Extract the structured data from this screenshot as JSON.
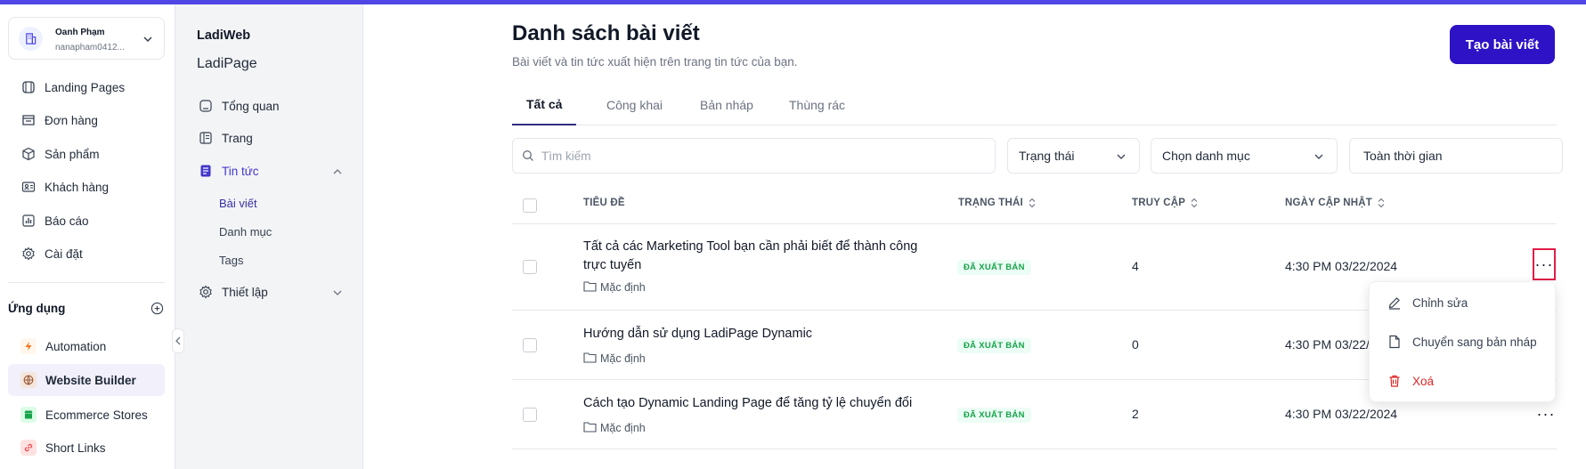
{
  "account": {
    "name": "Oanh Phạm",
    "email": "nanapham0412..."
  },
  "nav": [
    {
      "label": "Landing Pages",
      "icon": "landing-pages-icon"
    },
    {
      "label": "Đơn hàng",
      "icon": "orders-icon"
    },
    {
      "label": "Sản phẩm",
      "icon": "products-icon"
    },
    {
      "label": "Khách hàng",
      "icon": "customers-icon"
    },
    {
      "label": "Báo cáo",
      "icon": "report-icon"
    },
    {
      "label": "Cài đặt",
      "icon": "gear-icon"
    }
  ],
  "apps": {
    "title": "Ứng dụng",
    "items": [
      {
        "label": "Automation",
        "icon": "lightning-icon",
        "color": "#f97316"
      },
      {
        "label": "Website Builder",
        "icon": "globe-icon",
        "color": "#9a5b3a",
        "active": true
      },
      {
        "label": "Ecommerce Stores",
        "icon": "store-icon",
        "color": "#16a34a"
      },
      {
        "label": "Short Links",
        "icon": "link-icon",
        "color": "#ef4444"
      }
    ]
  },
  "sub_sidebar": {
    "brand": "LadiWeb",
    "site": "LadiPage",
    "items": [
      {
        "label": "Tổng quan",
        "icon": "dashboard-icon"
      },
      {
        "label": "Trang",
        "icon": "pages-icon"
      },
      {
        "label": "Tin tức",
        "icon": "news-icon",
        "active": true,
        "expanded": true
      },
      {
        "label": "Thiết lập",
        "icon": "gear-icon"
      }
    ],
    "news_children": [
      "Bài viết",
      "Danh mục",
      "Tags"
    ]
  },
  "header": {
    "title": "Danh sách bài viết",
    "subtitle": "Bài viết và tin tức xuất hiện trên trang tin tức của bạn.",
    "create_label": "Tạo bài viết"
  },
  "tabs": [
    "Tất cả",
    "Công khai",
    "Bản nháp",
    "Thùng rác"
  ],
  "filters": {
    "search_placeholder": "Tìm kiếm",
    "status": "Trạng thái",
    "category": "Chọn danh mục",
    "time": "Toàn thời gian"
  },
  "table": {
    "columns": [
      "TIÊU ĐỀ",
      "TRẠNG THÁI",
      "TRUY CẬP",
      "NGÀY CẬP NHẬT"
    ],
    "rows": [
      {
        "title": "Tất cả các Marketing Tool bạn cần phải biết để thành công trực tuyến",
        "category": "Mặc định",
        "status": "ĐÃ XUẤT BẢN",
        "visits": "4",
        "updated": "4:30 PM 03/22/2024"
      },
      {
        "title": "Hướng dẫn sử dụng LadiPage Dynamic",
        "category": "Mặc định",
        "status": "ĐÃ XUẤT BẢN",
        "visits": "0",
        "updated": "4:30 PM 03/22/2024"
      },
      {
        "title": "Cách tạo Dynamic Landing Page để tăng tỷ lệ chuyển đổi",
        "category": "Mặc định",
        "status": "ĐÃ XUẤT BẢN",
        "visits": "2",
        "updated": "4:30 PM 03/22/2024"
      }
    ]
  },
  "context_menu": [
    {
      "label": "Chỉnh sửa",
      "icon": "pencil-icon"
    },
    {
      "label": "Chuyển sang bản nháp",
      "icon": "draft-icon"
    },
    {
      "label": "Xoá",
      "icon": "trash-icon",
      "danger": true
    }
  ],
  "colors": {
    "accent": "#2e12c6",
    "top_bar": "#4f46e5",
    "published": "#16a34a",
    "danger": "#dc2626"
  }
}
